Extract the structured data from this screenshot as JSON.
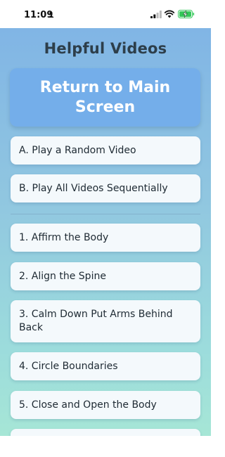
{
  "status_bar": {
    "time": "11:09",
    "icons": [
      "person-icon",
      "signal-icon",
      "wifi-icon",
      "battery-charging-icon"
    ],
    "battery_color": "#34c759"
  },
  "page": {
    "title": "Helpful Videos",
    "return_button": "Return to Main Screen"
  },
  "actions": [
    "A. Play a Random Video",
    "B. Play All Videos Sequentially"
  ],
  "videos": [
    "1. Affirm the Body",
    "2. Align the Spine",
    "3. Calm Down Put Arms Behind Back",
    "4. Circle Boundaries",
    "5. Close and Open the Body"
  ],
  "colors": {
    "button_blue": "#74aeea",
    "title_text": "#2d3e4a",
    "card_bg": "#f4f9fc"
  }
}
